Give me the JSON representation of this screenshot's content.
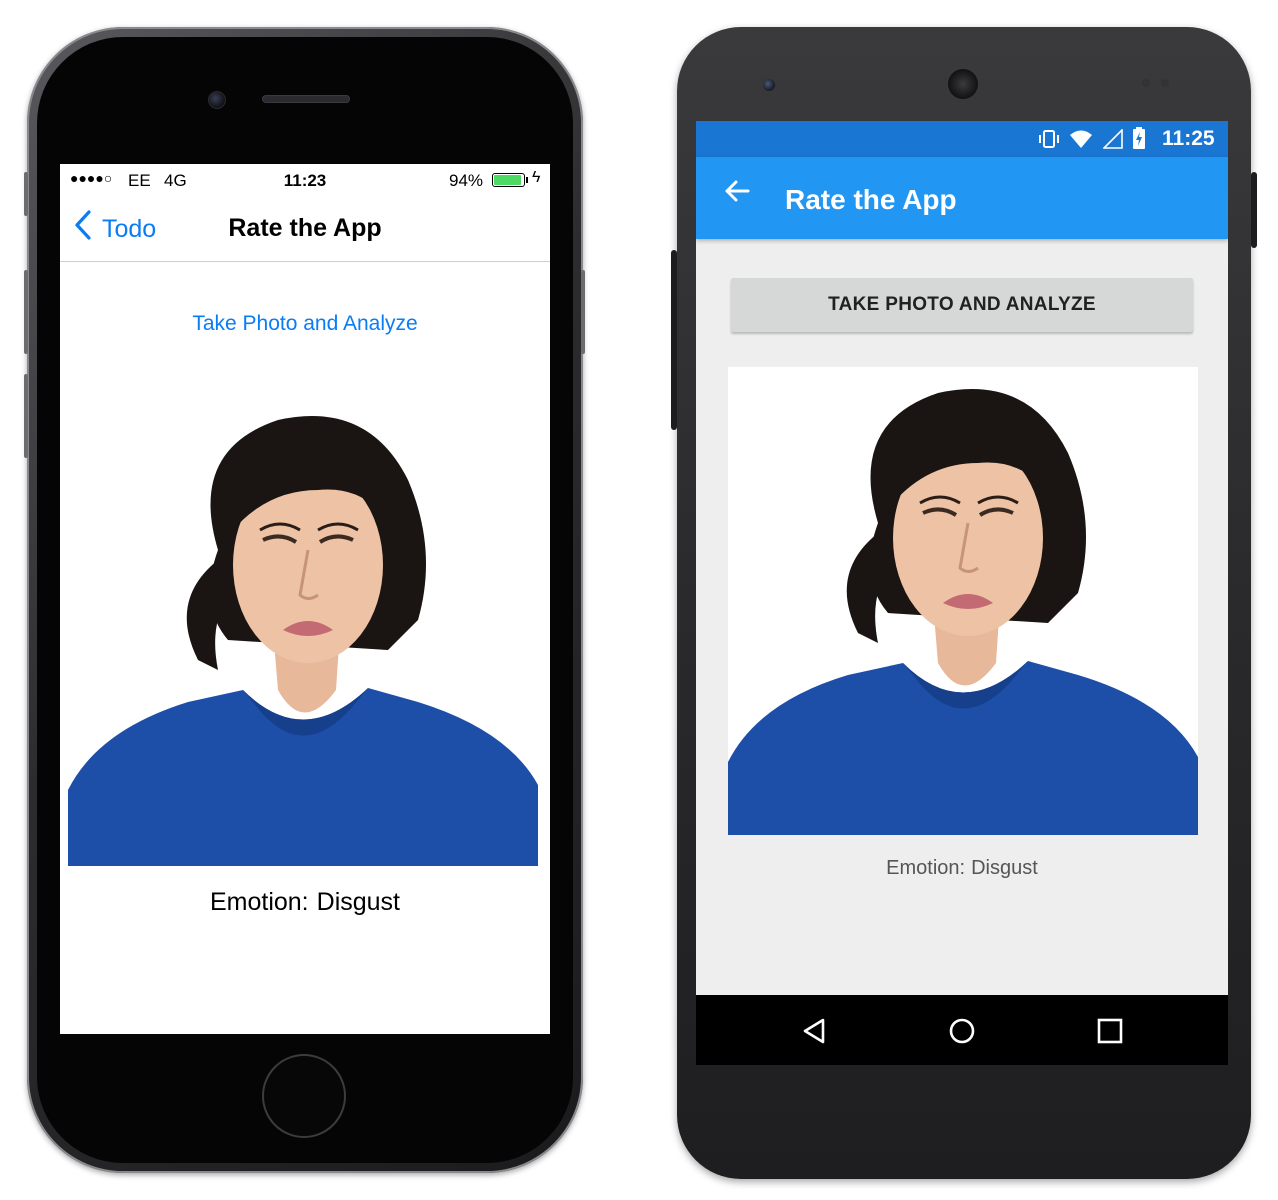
{
  "ios": {
    "status": {
      "signal": "●●●●○",
      "carrier": "EE",
      "network": "4G",
      "time": "11:23",
      "battery_percent": "94%",
      "battery_level": 0.94
    },
    "nav": {
      "back_label": "Todo",
      "title": "Rate the App"
    },
    "take_photo_label": "Take Photo and Analyze",
    "emotion_label": "Emotion:",
    "emotion_value": "Disgust"
  },
  "android": {
    "status": {
      "time": "11:25",
      "icons": [
        "vibrate-icon",
        "wifi-icon",
        "signal-icon",
        "battery-charging-icon"
      ]
    },
    "app_bar": {
      "title": "Rate the App"
    },
    "take_photo_label": "TAKE PHOTO AND ANALYZE",
    "emotion_label": "Emotion:",
    "emotion_value": "Disgust",
    "nav_buttons": [
      "back-icon",
      "home-icon",
      "recents-icon"
    ]
  },
  "colors": {
    "ios_tint": "#0a7cf5",
    "android_primary": "#2196f3",
    "android_primary_dark": "#1976d2",
    "shirt_blue": "#1d4fa8"
  }
}
